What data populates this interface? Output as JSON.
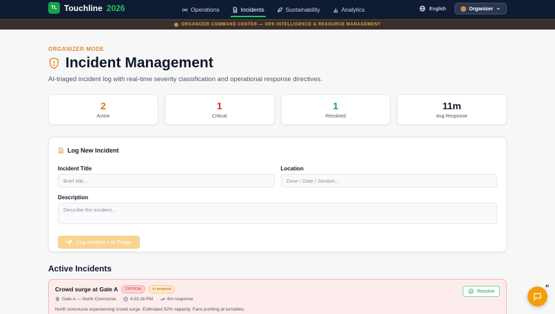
{
  "brand": {
    "logo": "TL",
    "name": "Touchline",
    "year": "2026"
  },
  "nav": {
    "links": [
      {
        "label": "Operations",
        "icon": "radio-icon"
      },
      {
        "label": "Incidents",
        "icon": "document-icon",
        "active": true
      },
      {
        "label": "Sustainability",
        "icon": "leaf-icon"
      },
      {
        "label": "Analytics",
        "icon": "bar-chart-icon"
      }
    ],
    "language": "English",
    "role": "Organizer"
  },
  "banner": {
    "text": "ORGANIZER COMMAND CENTER — OPS INTELLIGENCE & RESOURCE MANAGEMENT"
  },
  "page": {
    "mode": "ORGANIZER MODE",
    "title": "Incident Management",
    "subtitle": "AI-triaged incident log with real-time severity classification and operational response directives."
  },
  "stats": [
    {
      "value": "2",
      "label": "Active",
      "color": "#d97706"
    },
    {
      "value": "1",
      "label": "Critical",
      "color": "#dc2626"
    },
    {
      "value": "1",
      "label": "Resolved",
      "color": "#16a34a"
    },
    {
      "value": "11m",
      "label": "Avg Response",
      "color": "#111827"
    }
  ],
  "form": {
    "heading": "Log New Incident",
    "title_label": "Incident Title",
    "title_placeholder": "Brief title...",
    "location_label": "Location",
    "location_placeholder": "Zone / Gate / Section...",
    "description_label": "Description",
    "description_placeholder": "Describe the incident...",
    "submit_label": "Log Incident + AI Triage"
  },
  "incidents": {
    "heading": "Active Incidents",
    "items": [
      {
        "title": "Crowd surge at Gate A",
        "severity": "CRITICAL",
        "status": "In progress",
        "location": "Gate A — North Concourse",
        "time": "4:33:16 PM",
        "response": "8m response",
        "description": "North concourse experiencing crowd surge. Estimated 92% capacity. Fans pushing at turnstiles.",
        "action": "Resolve"
      }
    ]
  },
  "chat": {
    "tag": "AI"
  }
}
